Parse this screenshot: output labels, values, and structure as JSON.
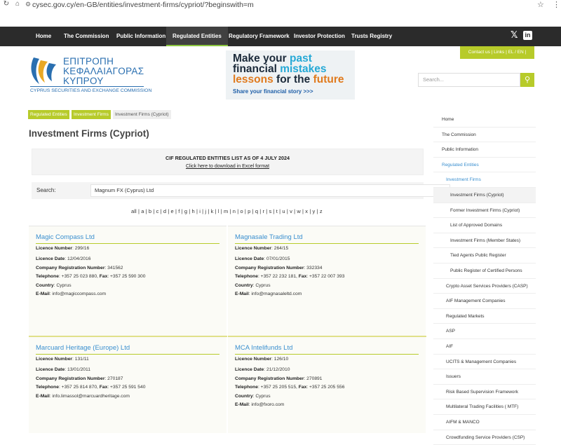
{
  "browser": {
    "url": "cysec.gov.cy/en-GB/entities/investment-firms/cypriot/?beginswith=m",
    "back_icon": "refresh-icon",
    "home_icon": "home-icon"
  },
  "nav": {
    "items": [
      "Home",
      "The Commission",
      "Public Information",
      "Regulated Entities",
      "Regulatory Framework",
      "Investor Protection",
      "Trusts Registry"
    ],
    "active": "Regulated Entities",
    "social_x": "𝕏",
    "social_in": "in"
  },
  "contact_bar": "Contact us  |  Links  |  EL / EN  |",
  "logo": {
    "line1": "ΕΠΙΤΡΟΠΗ",
    "line2": "ΚΕΦΑΛΑΙΑΓΟΡΑΣ",
    "line3": "ΚΥΠΡΟΥ",
    "line4": "CYPRUS SECURITIES AND EXCHANGE COMMISSION"
  },
  "banner": {
    "l1a": "Make your ",
    "l1b": "past",
    "l2a": "financial ",
    "l2b": "mistakes",
    "l3a": "lessons ",
    "l3b": "for the ",
    "l3c": "future",
    "l4": "Share your financial story >>>"
  },
  "search": {
    "placeholder": "Search..."
  },
  "breadcrumb": [
    "Regulated Entities",
    "Investment Firms",
    "Investment Firms (Cypriot)"
  ],
  "page_title": "Investment Firms (Cypriot)",
  "notice": {
    "title": "CIF REGULATED ENTITIES LIST AS OF 4 JULY 2024",
    "download": "Click here to download in Excel format"
  },
  "filter": {
    "label": "Search:",
    "value": "Magnum FX (Cyprus) Ltd"
  },
  "alphabet": "all | a | b | c | d | e | f | g | h | i | j | k | l | m | n | o | p | q | r | s | t | u | v | w | x | y | z",
  "labels": {
    "licence_number": "Licence Number",
    "licence_date": "Licence Date",
    "company_reg": "Company Registration Number",
    "telephone": "Telephone",
    "fax": "Fax",
    "country": "Country",
    "email": "E-Mail"
  },
  "firms": [
    {
      "name": "Magic Compass Ltd",
      "licence_number": ": 299/16",
      "licence_date": ": 12/04/2016",
      "company_reg": ": 341562",
      "telephone": ": +357 25 023 880, ",
      "fax": ": +357 25 590 300",
      "country": ": Cyprus",
      "email": ": info@magiccompass.com"
    },
    {
      "name": "Magnasale Trading Ltd",
      "licence_number": ": 264/15",
      "licence_date": ": 07/01/2015",
      "company_reg": ": 332334",
      "telephone": ": +357 22 232 181, ",
      "fax": ": +357 22 007 393",
      "country": ": Cyprus",
      "email": ": info@magnasaleltd.com"
    },
    {
      "name": "Marcuard Heritage (Europe) Ltd",
      "licence_number": ": 131/11",
      "licence_date": ": 13/01/2011",
      "company_reg": ": 270187",
      "telephone": ": +357 25 814 870, ",
      "fax": ": +357 25 591 540",
      "email": ": info.limassol@marcuardheritage.com"
    },
    {
      "name": "MCA Intelifunds Ltd",
      "licence_number": ": 126/10",
      "licence_date": ": 21/12/2010",
      "company_reg": ": 270891",
      "telephone": ": +357 25 205 515, ",
      "fax": ": +357 25 205 556",
      "country": ": Cyprus",
      "email": ": info@fxoro.com"
    }
  ],
  "sidebar": [
    {
      "label": "Home",
      "level": 0
    },
    {
      "label": "The Commission",
      "level": 0
    },
    {
      "label": "Public Information",
      "level": 0
    },
    {
      "label": "Regulated Entities",
      "level": 0,
      "sub": true
    },
    {
      "label": "Investment Firms",
      "level": 1,
      "sub": true
    },
    {
      "label": "Investment Firms (Cypriot)",
      "level": 2,
      "selected": true
    },
    {
      "label": "Former Investment Firms (Cypriot)",
      "level": 2
    },
    {
      "label": "List of Approved Domains",
      "level": 2
    },
    {
      "label": "Investment Firms (Member States)",
      "level": 2
    },
    {
      "label": "Tied Agents Public Register",
      "level": 2
    },
    {
      "label": "Public Register of Certified Persons",
      "level": 2
    },
    {
      "label": "Crypto Asset Services Providers (CASP)",
      "level": 1
    },
    {
      "label": "AIF Management Companies",
      "level": 1
    },
    {
      "label": "Regulated Markets",
      "level": 1
    },
    {
      "label": "ASP",
      "level": 1
    },
    {
      "label": "AIF",
      "level": 1
    },
    {
      "label": "UCITS & Management Companies",
      "level": 1
    },
    {
      "label": "Issuers",
      "level": 1
    },
    {
      "label": "Risk Based Supervision Framework",
      "level": 1
    },
    {
      "label": "Multilateral Trading Facilities ( MTF)",
      "level": 1
    },
    {
      "label": "AIFM & MANCO",
      "level": 1
    },
    {
      "label": "Crowdfunding Service Providers (CSP)",
      "level": 1
    }
  ]
}
